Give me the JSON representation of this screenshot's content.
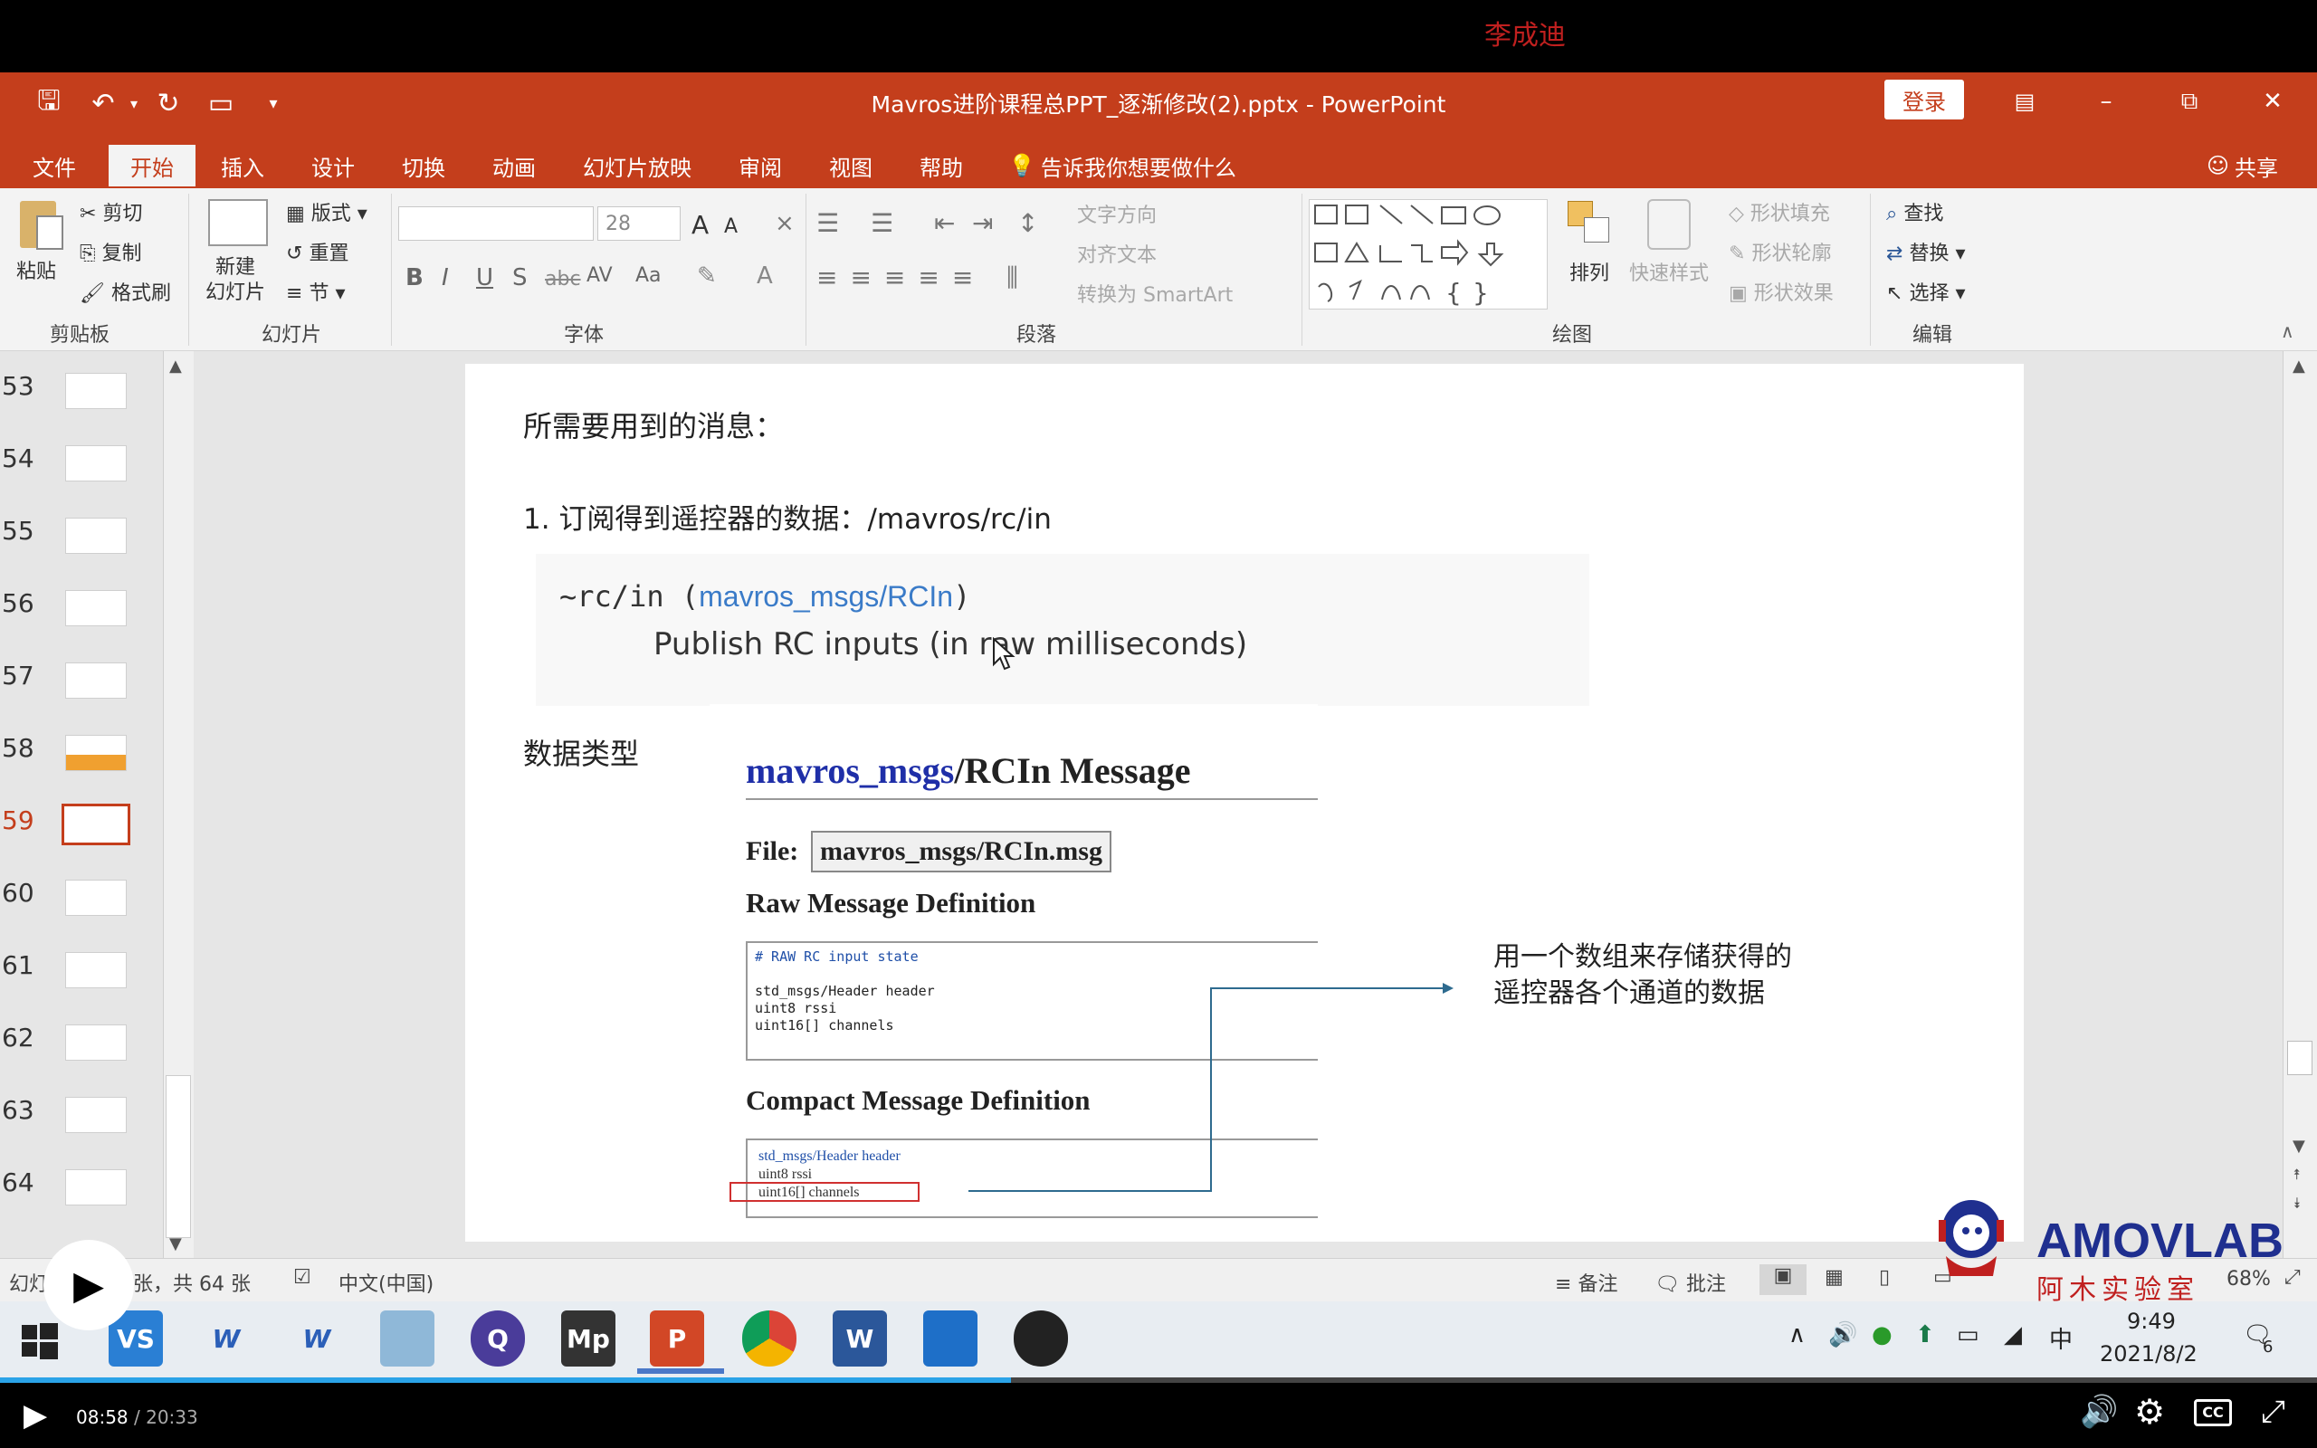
{
  "overlay": {
    "watermark": "李成迪"
  },
  "window": {
    "title": "Mavros进阶课程总PPT_逐渐修改(2).pptx  -  PowerPoint",
    "login_label": "登录"
  },
  "tabs": [
    "文件",
    "开始",
    "插入",
    "设计",
    "切换",
    "动画",
    "幻灯片放映",
    "审阅",
    "视图",
    "帮助",
    "告诉我你想要做什么"
  ],
  "share_label": "共享",
  "ribbon": {
    "clipboard": {
      "paste": "粘贴",
      "cut": "剪切",
      "copy": "复制",
      "format_painter": "格式刷",
      "label": "剪贴板"
    },
    "slides": {
      "new_slide": "新建\n幻灯片",
      "layout": "版式",
      "reset": "重置",
      "section": "节",
      "label": "幻灯片"
    },
    "font": {
      "font_size": "28",
      "label": "字体",
      "bold": "B",
      "italic": "I",
      "underline": "U",
      "shadow": "S",
      "strike": "abc",
      "spacing": "AV",
      "case": "Aa",
      "grow": "A",
      "shrink": "A"
    },
    "paragraph": {
      "text_direction": "文字方向",
      "align_text": "对齐文本",
      "smartart": "转换为 SmartArt",
      "label": "段落"
    },
    "drawing": {
      "arrange": "排列",
      "quick_styles": "快速样式",
      "shape_fill": "形状填充",
      "shape_outline": "形状轮廓",
      "shape_effects": "形状效果",
      "label": "绘图"
    },
    "editing": {
      "find": "查找",
      "replace": "替换",
      "select": "选择",
      "label": "编辑"
    }
  },
  "thumbnails": [
    {
      "num": "53"
    },
    {
      "num": "54"
    },
    {
      "num": "55"
    },
    {
      "num": "56"
    },
    {
      "num": "57"
    },
    {
      "num": "58"
    },
    {
      "num": "59"
    },
    {
      "num": "60"
    },
    {
      "num": "61"
    },
    {
      "num": "62"
    },
    {
      "num": "63"
    },
    {
      "num": "64"
    }
  ],
  "selected_slide": "59",
  "slide": {
    "heading": "所需要用到的消息：",
    "item1_prefix": "1. 订阅得到遥控器的数据：",
    "item1_topic": "/mavros/rc/in",
    "code_topic": "~rc/in (",
    "code_link": "mavros_msgs/RCIn",
    "code_close": ")",
    "code_desc": "Publish RC inputs (in raw milliseconds)",
    "data_type_label": "数据类型",
    "msg_title_pkg": "mavros_msgs",
    "msg_title_rest": "/RCIn Message",
    "file_label": "File:",
    "file_value": "mavros_msgs/RCIn.msg",
    "raw_def_title": "Raw Message Definition",
    "raw_def_lines": [
      "# RAW RC input state",
      "",
      "std_msgs/Header header",
      "uint8 rssi",
      "uint16[] channels"
    ],
    "compact_title": "Compact Message Definition",
    "compact_lines": [
      "std_msgs/Header header",
      "uint8 rssi",
      "uint16[] channels"
    ],
    "annotation_line1": "用一个数组来存储获得的",
    "annotation_line2": "遥控器各个通道的数据"
  },
  "status": {
    "slide_info": "幻灯片 第 59 张，共 64 张",
    "language": "中文(中国)",
    "notes": "备注",
    "comments": "批注",
    "zoom": "68%"
  },
  "brand": {
    "name": "AMOVLAB",
    "sub": "阿木实验室"
  },
  "taskbar": {
    "apps": [
      "VS",
      "W",
      "W",
      "",
      "Q",
      "Mp",
      "P",
      "",
      "W",
      "",
      ""
    ],
    "time": "9:49",
    "date": "2021/8/2",
    "ime": "中",
    "notif_count": "6"
  },
  "player": {
    "current": "08:58",
    "total": "20:33",
    "progress": 0.4365
  },
  "colors": {
    "accent": "#c43e1c",
    "link": "#1f4fa8",
    "arrow": "#2e6b8f",
    "highlight_box": "#d03030"
  }
}
